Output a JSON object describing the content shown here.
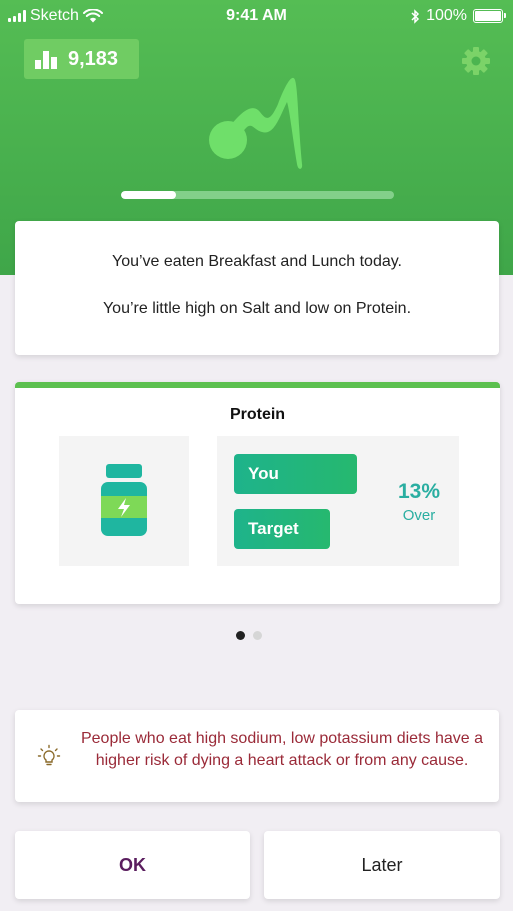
{
  "status_bar": {
    "carrier": "Sketch",
    "time": "9:41 AM",
    "battery": "100%",
    "icons": [
      "signal-icon",
      "wifi-icon",
      "bluetooth-icon",
      "battery-icon"
    ]
  },
  "header": {
    "steps_count": "9,183",
    "steps_icon": "bar-chart-icon",
    "settings_icon": "gear-icon",
    "logo_icon": "app-logo-icon",
    "daily_progress": 0.2,
    "accent_color": "#4cb550"
  },
  "summary": {
    "line1": "You’ve eaten Breakfast and Lunch today.",
    "line2": "You’re little high on Salt and low on Protein."
  },
  "nutrient_card": {
    "title": "Protein",
    "icon": "supplement-jar-icon",
    "you_label": "You",
    "target_label": "Target",
    "percent": "13%",
    "percent_label": "Over"
  },
  "pager": {
    "count": 2,
    "active_index": 0
  },
  "tip": {
    "icon": "lightbulb-icon",
    "text": "People who eat high sodium, low potassium diets have a higher risk of dying a heart attack or from any cause."
  },
  "actions": {
    "ok_label": "OK",
    "later_label": "Later"
  }
}
